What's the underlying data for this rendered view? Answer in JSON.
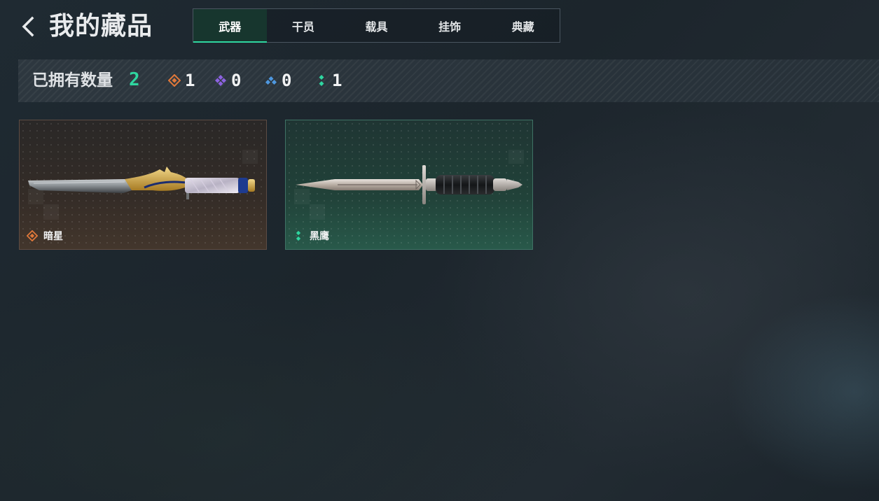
{
  "header": {
    "title": "我的藏品",
    "back_icon": "chevron-left-icon"
  },
  "tabs": [
    {
      "label": "武器",
      "active": true
    },
    {
      "label": "干员",
      "active": false
    },
    {
      "label": "载具",
      "active": false
    },
    {
      "label": "挂饰",
      "active": false
    },
    {
      "label": "典藏",
      "active": false
    }
  ],
  "summary": {
    "label": "已拥有数量",
    "total": "2",
    "rarities": [
      {
        "icon": "orange-diamond-icon",
        "color": "#e0783a",
        "count": "1"
      },
      {
        "icon": "purple-diamond-icon",
        "color": "#8c62e0",
        "count": "0"
      },
      {
        "icon": "blue-diamond-icon",
        "color": "#4e98e0",
        "count": "0"
      },
      {
        "icon": "green-diamond-icon",
        "color": "#2fd6a0",
        "count": "1"
      }
    ]
  },
  "items": [
    {
      "name": "暗星",
      "rarity_icon": "orange-diamond-icon",
      "rarity_color": "#e0783a",
      "art": "ornate-knife-image"
    },
    {
      "name": "黑鹰",
      "rarity_icon": "green-diamond-icon",
      "rarity_color": "#2fd6a0",
      "art": "combat-dagger-image"
    }
  ],
  "colors": {
    "accent_green": "#2fd6a0",
    "active_tab_bg": "#17362e"
  }
}
